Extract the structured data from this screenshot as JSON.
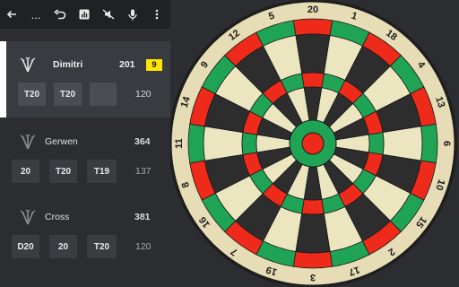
{
  "toolbar": {
    "icons": [
      "back-arrow-icon",
      "more-horizontal-icon",
      "undo-icon",
      "stats-icon",
      "mute-icon",
      "microphone-icon",
      "more-vertical-icon"
    ],
    "ellipsis": "..."
  },
  "players": [
    {
      "name": "Dimitri",
      "score": "201",
      "badge": "9",
      "darts": [
        "T20",
        "T20",
        ""
      ],
      "total": "120"
    },
    {
      "name": "Gerwen",
      "score": "364",
      "darts": [
        "20",
        "T20",
        "T19"
      ],
      "total": "137"
    },
    {
      "name": "Cross",
      "score": "381",
      "darts": [
        "D20",
        "20",
        "T20"
      ],
      "total": "120"
    }
  ],
  "board": {
    "numbers": [
      "20",
      "1",
      "18",
      "4",
      "13",
      "6",
      "10",
      "15",
      "2",
      "17",
      "3",
      "19",
      "7",
      "16",
      "8",
      "11",
      "14",
      "9",
      "12",
      "5"
    ],
    "colors": {
      "rim": "#1f1f1f",
      "number_ring": "#e6dcb5",
      "light_segment": "#ece6c0",
      "dark_segment": "#2d2d2d",
      "red": "#ee2a1a",
      "green": "#1fa456",
      "wire": "#1a1a1a"
    }
  }
}
